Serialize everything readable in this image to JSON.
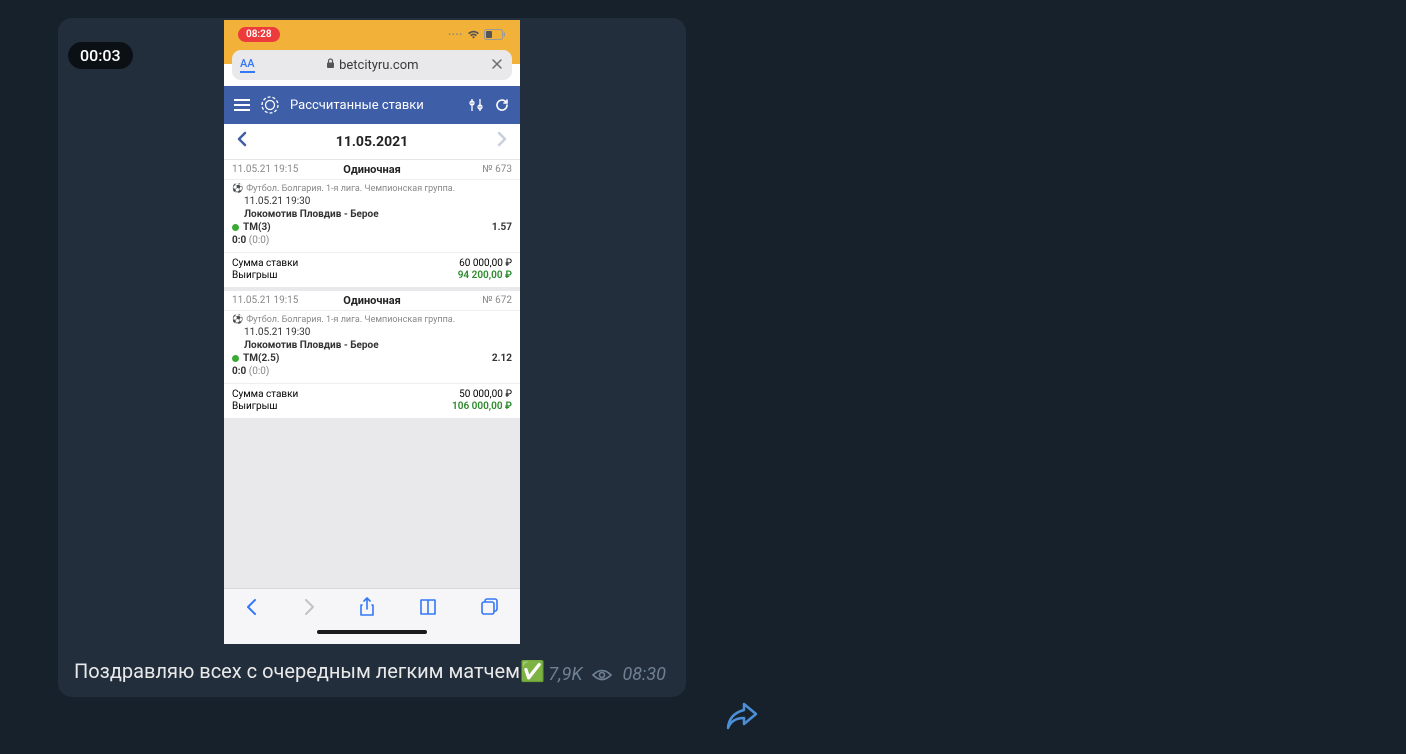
{
  "telegram": {
    "video_time": "00:03",
    "caption": "Поздравляю всех с очередным легким матчем✅",
    "views": "7,9K",
    "time": "08:30"
  },
  "phone": {
    "status_time": "08:28",
    "url": "betcityru.com",
    "aa": "AA"
  },
  "app": {
    "title": "Рассчитанные ставки",
    "date": "11.05.2021"
  },
  "bets": [
    {
      "placed_at": "11.05.21 19:15",
      "type": "Одиночная",
      "number": "№ 673",
      "league": "Футбол. Болгария. 1-я лига. Чемпионская группа.",
      "event_time": "11.05.21 19:30",
      "teams": "Локомотив Пловдив - Берое",
      "market": "ТМ(3)",
      "odds": "1.57",
      "score": "0:0",
      "score_paren": "(0:0)",
      "stake_label": "Сумма ставки",
      "stake_value": "60 000,00 ₽",
      "win_label": "Выигрыш",
      "win_value": "94 200,00 ₽"
    },
    {
      "placed_at": "11.05.21 19:15",
      "type": "Одиночная",
      "number": "№ 672",
      "league": "Футбол. Болгария. 1-я лига. Чемпионская группа.",
      "event_time": "11.05.21 19:30",
      "teams": "Локомотив Пловдив - Берое",
      "market": "ТМ(2.5)",
      "odds": "2.12",
      "score": "0:0",
      "score_paren": "(0:0)",
      "stake_label": "Сумма ставки",
      "stake_value": "50 000,00 ₽",
      "win_label": "Выигрыш",
      "win_value": "106 000,00 ₽"
    }
  ]
}
